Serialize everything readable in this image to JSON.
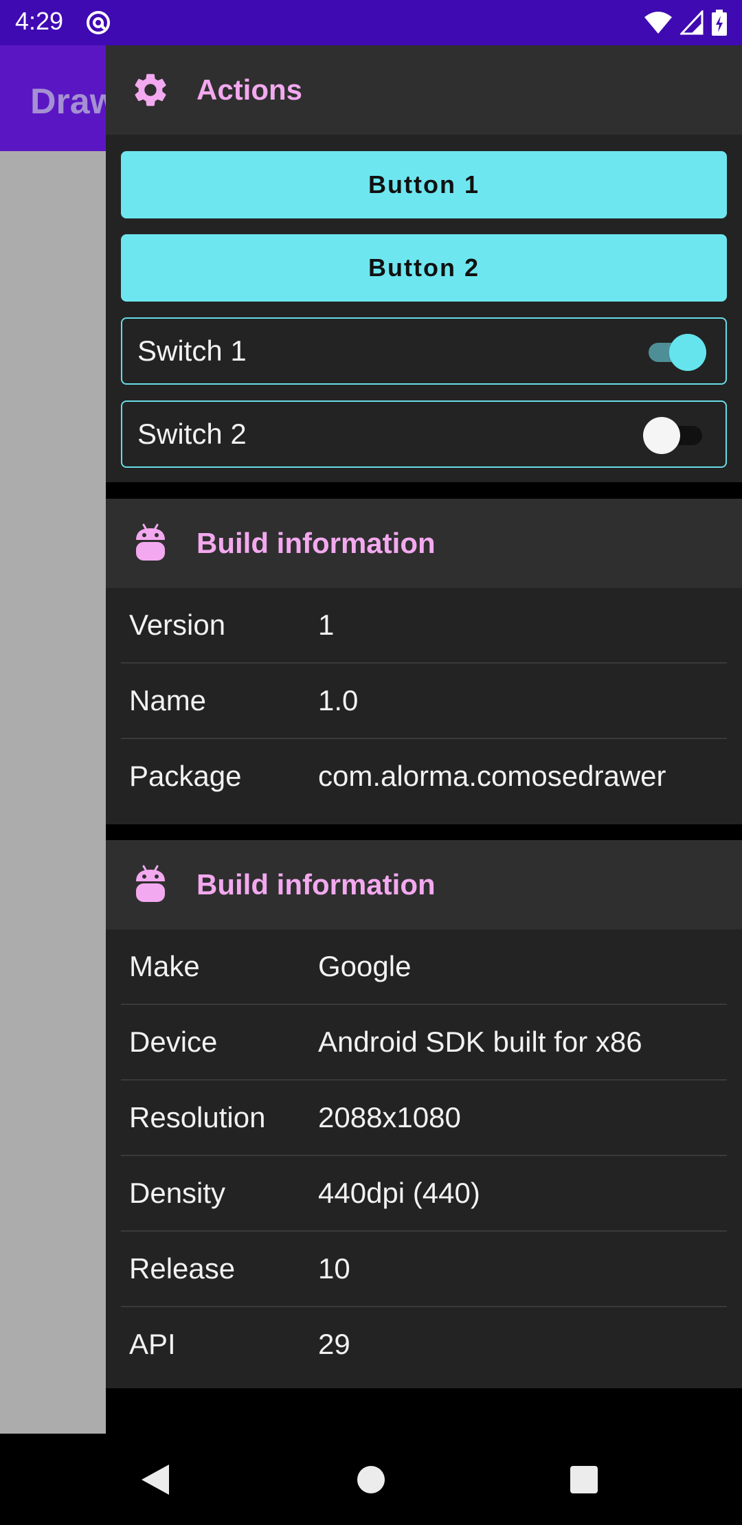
{
  "status_bar": {
    "time": "4:29"
  },
  "app_bar": {
    "title": "Draw"
  },
  "actions_card": {
    "title": "Actions",
    "icon": "gear-icon",
    "buttons": [
      {
        "label": "Button 1"
      },
      {
        "label": "Button 2"
      }
    ],
    "switches": [
      {
        "label": "Switch 1",
        "checked": true
      },
      {
        "label": "Switch 2",
        "checked": false
      }
    ]
  },
  "build_card": {
    "title": "Build information",
    "icon": "android-icon",
    "rows": [
      {
        "key": "Version",
        "value": "1"
      },
      {
        "key": "Name",
        "value": "1.0"
      },
      {
        "key": "Package",
        "value": "com.alorma.comosedrawer"
      }
    ]
  },
  "device_card": {
    "title": "Build information",
    "icon": "android-icon",
    "rows": [
      {
        "key": "Make",
        "value": "Google"
      },
      {
        "key": "Device",
        "value": "Android SDK built for x86"
      },
      {
        "key": "Resolution",
        "value": "2088x1080"
      },
      {
        "key": "Density",
        "value": "440dpi (440)"
      },
      {
        "key": "Release",
        "value": "10"
      },
      {
        "key": "API",
        "value": "29"
      }
    ]
  },
  "colors": {
    "status_bar": "#3f0ab2",
    "app_bar": "#5b16c4",
    "accent": "#6ee6ef",
    "header_text": "#f3a9ef",
    "card_bg": "#232323"
  }
}
